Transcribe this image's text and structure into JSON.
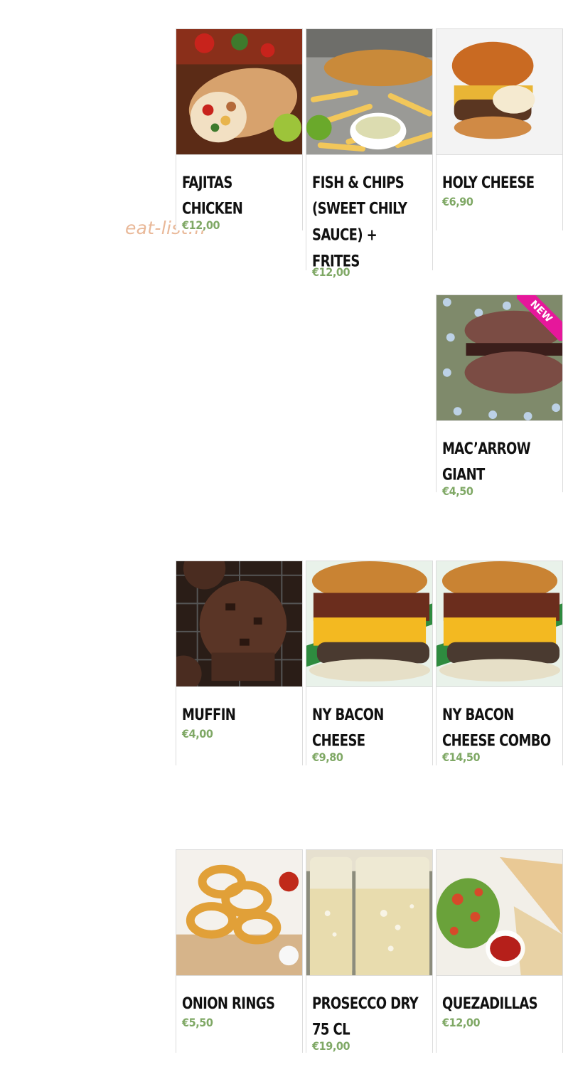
{
  "watermark": "eat-list.fr",
  "products": [
    {
      "name": "Fajitas Chicken",
      "price": "€12,00"
    },
    {
      "name": "Fish & Chips (Sweet chily sauce) + Frites",
      "price": "€12,00"
    },
    {
      "name": "Holy Cheese",
      "price": "€6,90"
    },
    {
      "name": "Mac’arrow Giant",
      "price": "€4,50",
      "badge": "NEW"
    },
    {
      "name": "Muffin",
      "price": "€4,00"
    },
    {
      "name": "NY Bacon Cheese",
      "price": "€9,80"
    },
    {
      "name": "NY Bacon Cheese Combo",
      "price": "€14,50"
    },
    {
      "name": "Onion Rings",
      "price": "€5,50"
    },
    {
      "name": "Prosecco Dry 75 cl",
      "price": "€19,00"
    },
    {
      "name": "Quezadillas",
      "price": "€12,00"
    }
  ],
  "colors": {
    "price": "#7fa865",
    "badge": "#e6179b",
    "watermark": "#e9b898"
  }
}
